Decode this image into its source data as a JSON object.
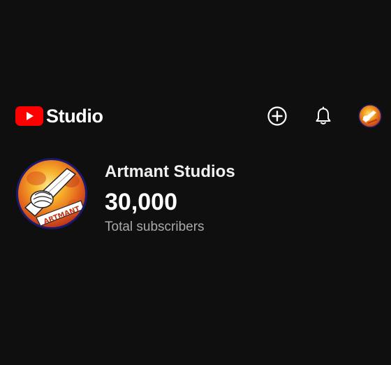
{
  "header": {
    "logo": {
      "brand_icon": "youtube-play-icon",
      "brand_color": "#ff0000",
      "product_name": "Studio"
    },
    "actions": {
      "create_icon": "plus-circle-icon",
      "notifications_icon": "bell-icon",
      "account_icon": "avatar-icon"
    }
  },
  "channel": {
    "name": "Artmant Studios",
    "subscriber_count": "30,000",
    "subscriber_label": "Total subscribers",
    "avatar_text": "ARTMANT",
    "avatar_colors": {
      "ring": "#1a1a6e",
      "fire": "#f29a1a",
      "fire_dark": "#c0391b"
    }
  },
  "colors": {
    "background": "#0f0f0f",
    "primary_text": "#ffffff",
    "secondary_text": "#aaaaaa"
  }
}
